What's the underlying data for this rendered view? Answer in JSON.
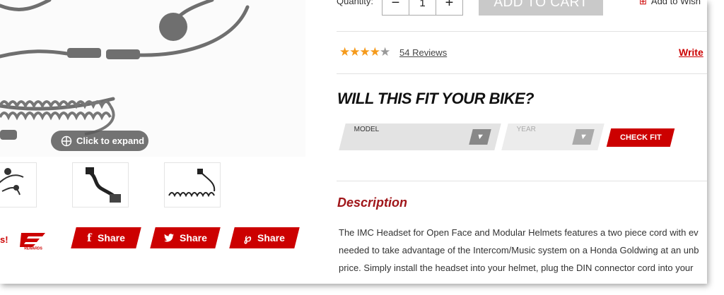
{
  "gallery": {
    "expand_label": "Click to expand"
  },
  "promo": {
    "text": "s!",
    "rewards_logo_text": "REWARDS"
  },
  "share": {
    "facebook_label": "Share",
    "twitter_label": "Share",
    "pinterest_label": "Share"
  },
  "purchase": {
    "quantity_label": "Quantity:",
    "quantity_value": "1",
    "minus": "−",
    "plus": "+",
    "add_to_cart": "ADD TO CART",
    "wishlist": "Add to Wish"
  },
  "reviews": {
    "rating": 4,
    "max": 5,
    "count_label": "54 Reviews",
    "write_label": "Write"
  },
  "fit": {
    "title": "WILL THIS FIT YOUR BIKE?",
    "model_label": "MODEL",
    "year_label": "YEAR",
    "check_label": "CHECK FIT"
  },
  "description": {
    "title": "Description",
    "lines": [
      "The IMC Headset for Open Face and Modular Helmets features a two piece cord with ev",
      "needed to take advantage of the Intercom/Music system on a Honda Goldwing at an unb",
      "price. Simply install the headset into your helmet, plug the DIN connector cord into your"
    ]
  },
  "colors": {
    "brand_red": "#cc0000",
    "star": "#f59a1b",
    "disabled_button": "#c9c9c9"
  }
}
